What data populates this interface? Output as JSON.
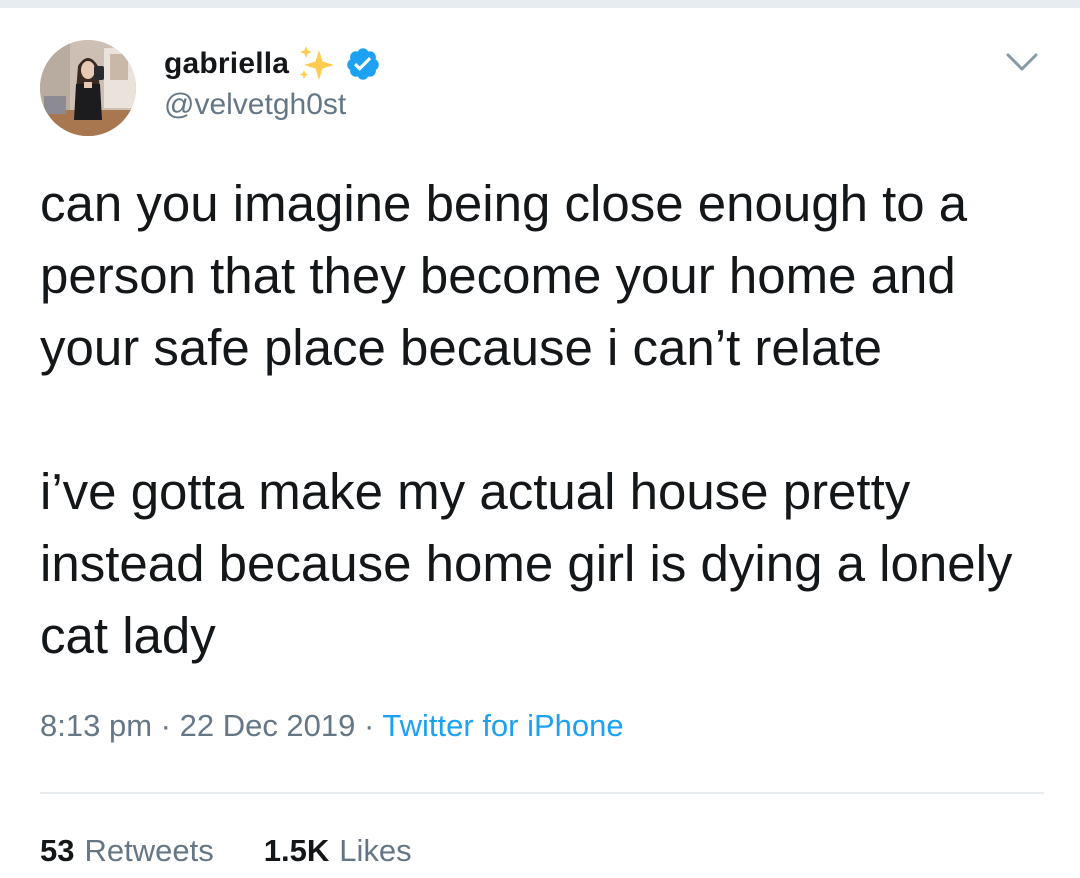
{
  "tweet": {
    "author": {
      "display_name": "gabriella",
      "handle": "@velvetgh0st",
      "emoji_icon": "sparkles-icon",
      "verified_icon": "verified-badge-icon"
    },
    "menu_icon": "chevron-down-icon",
    "text_paragraphs": [
      "can you imagine being close enough to a person that they become your home and your safe place because i can’t relate",
      "i’ve gotta make my actual house pretty instead because home girl is dying a lonely cat lady"
    ],
    "time": "8:13 pm",
    "separator": "·",
    "date": "22 Dec 2019",
    "source": "Twitter for iPhone",
    "stats": {
      "retweets_count": "53",
      "retweets_label": "Retweets",
      "likes_count": "1.5K",
      "likes_label": "Likes"
    },
    "colors": {
      "text": "#14171a",
      "secondary": "#657786",
      "link": "#1da1f2",
      "verified": "#1da1f2",
      "sparkle": "#ffcc4d",
      "divider": "#e6ecf0"
    }
  }
}
